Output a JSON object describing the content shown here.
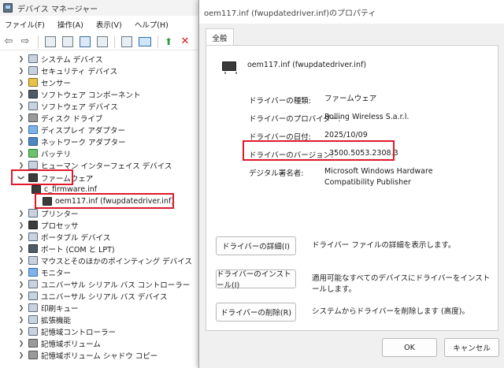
{
  "device_manager": {
    "title": "デバイス マネージャー",
    "menu": [
      "ファイル(F)",
      "操作(A)",
      "表示(V)",
      "ヘルプ(H)"
    ],
    "tree": [
      {
        "label": "システム デバイス",
        "expanded": false
      },
      {
        "label": "セキュリティ デバイス",
        "expanded": false
      },
      {
        "label": "センサー",
        "expanded": false
      },
      {
        "label": "ソフトウェア コンポーネント",
        "expanded": false
      },
      {
        "label": "ソフトウェア デバイス",
        "expanded": false
      },
      {
        "label": "ディスク ドライブ",
        "expanded": false
      },
      {
        "label": "ディスプレイ アダプター",
        "expanded": false
      },
      {
        "label": "ネットワーク アダプター",
        "expanded": false
      },
      {
        "label": "バッテリ",
        "expanded": false
      },
      {
        "label": "ヒューマン インターフェイス デバイス",
        "expanded": false
      },
      {
        "label": "ファームウェア",
        "expanded": true
      },
      {
        "label": "c_firmware.inf",
        "child": true
      },
      {
        "label": "oem117.inf (fwupdatedriver.inf)",
        "child": true
      },
      {
        "label": "プリンター",
        "expanded": false
      },
      {
        "label": "プロセッサ",
        "expanded": false
      },
      {
        "label": "ポータブル デバイス",
        "expanded": false
      },
      {
        "label": "ポート (COM と LPT)",
        "expanded": false
      },
      {
        "label": "マウスとそのほかのポインティング デバイス",
        "expanded": false
      },
      {
        "label": "モニター",
        "expanded": false
      },
      {
        "label": "ユニバーサル シリアル バス コントローラー",
        "expanded": false
      },
      {
        "label": "ユニバーサル シリアル バス デバイス",
        "expanded": false
      },
      {
        "label": "印刷キュー",
        "expanded": false
      },
      {
        "label": "拡張機能",
        "expanded": false
      },
      {
        "label": "記憶域コントローラー",
        "expanded": false
      },
      {
        "label": "記憶域ボリューム",
        "expanded": false
      },
      {
        "label": "記憶域ボリューム シャドウ コピー",
        "expanded": false
      }
    ]
  },
  "dialog": {
    "title": "oem117.inf (fwupdatedriver.inf)のプロパティ",
    "tab": "全般",
    "device_name": "oem117.inf (fwupdatedriver.inf)",
    "props": [
      {
        "label": "ドライバーの種類:",
        "value": "ファームウェア"
      },
      {
        "label": "ドライバーのプロバイダー:",
        "value": "Rolling Wireless S.a.r.l."
      },
      {
        "label": "ドライバーの日付:",
        "value": "2025/10/09"
      },
      {
        "label": "ドライバーのバージョン:",
        "value": "3500.5053.2308.3"
      },
      {
        "label": "デジタル署名者:",
        "value": "Microsoft Windows Hardware Compatibility Publisher"
      }
    ],
    "buttons": [
      {
        "label": "ドライバーの詳細(I)",
        "desc": "ドライバー ファイルの詳細を表示します。"
      },
      {
        "label": "ドライバーのインストール(I)",
        "desc": "適用可能なすべてのデバイスにドライバーをインストールします。"
      },
      {
        "label": "ドライバーの削除(R)",
        "desc": "システムからドライバーを削除します (高度)。"
      }
    ],
    "ok": "OK",
    "cancel": "キャンセル"
  },
  "colors": {
    "highlight_box": "#e0182a"
  }
}
